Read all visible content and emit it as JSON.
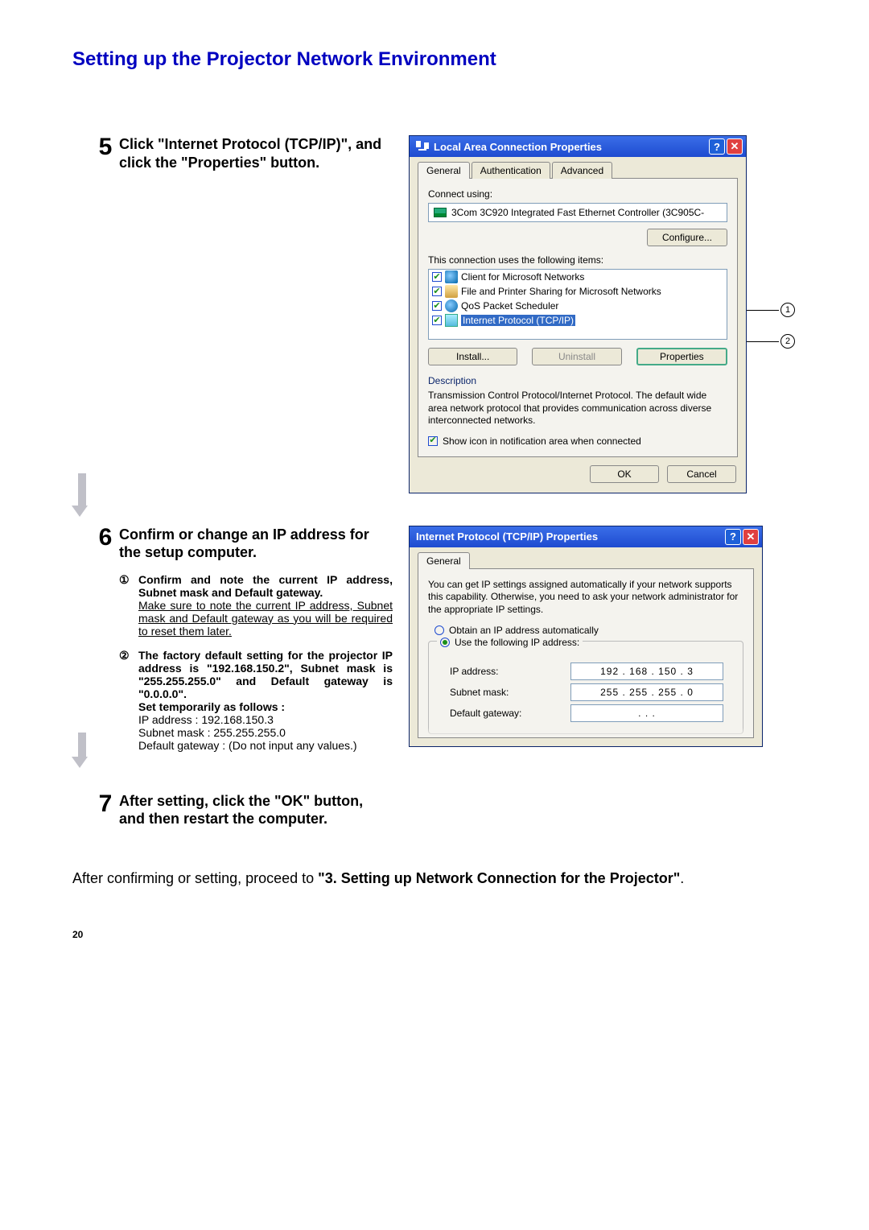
{
  "page_title": "Setting up the Projector Network Environment",
  "page_number": "20",
  "final_note_prefix": "After confirming or setting, proceed to ",
  "final_note_bold": "\"3. Setting up Network Connection for the Projector\"",
  "final_note_suffix": ".",
  "steps": {
    "s5": {
      "num": "5",
      "heading": "Click \"Internet Protocol (TCP/IP)\", and click the \"Properties\" button."
    },
    "s6": {
      "num": "6",
      "heading": "Confirm or change an IP address for the setup computer.",
      "sub1_marker": "①",
      "sub1_bold": "Confirm and note the current IP address, Subnet mask and Default gateway.",
      "sub1_under": "Make sure to note the current IP address, Subnet mask and Default gateway as you will be required to reset them later.",
      "sub2_marker": "②",
      "sub2_bold_a": "The factory default setting for the projector IP address is \"192.168.150.2\", Subnet mask is \"255.255.255.0\" and Default gateway is \"0.0.0.0\".",
      "sub2_bold_b": "Set  temporarily as follows :",
      "sub2_line1": "IP address : 192.168.150.3",
      "sub2_line2": "Subnet mask : 255.255.255.0",
      "sub2_line3": "Default gateway : (Do not input any values.)"
    },
    "s7": {
      "num": "7",
      "heading": "After setting, click the \"OK\" button, and then restart the computer."
    }
  },
  "dialog1": {
    "title": "Local Area Connection Properties",
    "tabs": [
      "General",
      "Authentication",
      "Advanced"
    ],
    "connect_using_label": "Connect using:",
    "nic": "3Com 3C920 Integrated Fast Ethernet Controller (3C905C-",
    "configure_btn": "Configure...",
    "uses_label": "This connection uses the following items:",
    "items": [
      "Client for Microsoft Networks",
      "File and Printer Sharing for Microsoft Networks",
      "QoS Packet Scheduler",
      "Internet Protocol (TCP/IP)"
    ],
    "install_btn": "Install...",
    "uninstall_btn": "Uninstall",
    "properties_btn": "Properties",
    "desc_label": "Description",
    "desc_text": "Transmission Control Protocol/Internet Protocol. The default wide area network protocol that provides communication across diverse interconnected networks.",
    "show_icon": "Show icon in notification area when connected",
    "ok_btn": "OK",
    "cancel_btn": "Cancel",
    "callout1": "1",
    "callout2": "2"
  },
  "dialog2": {
    "title": "Internet Protocol (TCP/IP) Properties",
    "tab": "General",
    "intro": "You can get IP settings assigned automatically if your network supports this capability. Otherwise, you need to ask your network administrator for the appropriate IP settings.",
    "radio_auto": "Obtain an IP address automatically",
    "radio_manual": "Use the following IP address:",
    "ip_label": "IP address:",
    "ip_value": "192 . 168 . 150 .   3",
    "subnet_label": "Subnet mask:",
    "subnet_value": "255 . 255 . 255 .   0",
    "gateway_label": "Default gateway:",
    "gateway_value": ".        .        ."
  }
}
